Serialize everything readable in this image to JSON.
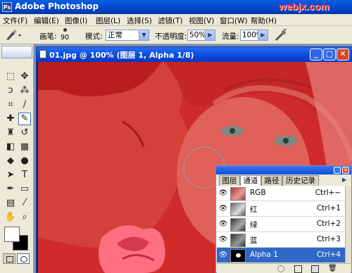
{
  "app": {
    "title": "Adobe Photoshop",
    "watermark": "webjx.com"
  },
  "menu": [
    "文件(F)",
    "编辑(E)",
    "图像(I)",
    "图层(L)",
    "选择(S)",
    "滤镜(T)",
    "视图(V)",
    "窗口(W)",
    "帮助(H)"
  ],
  "options": {
    "brush_label": "画笔:",
    "brush_size": "90",
    "mode_label": "模式:",
    "mode_value": "正常",
    "opacity_label": "不透明度:",
    "opacity_value": "50%",
    "flow_label": "流量:",
    "flow_value": "100%"
  },
  "document": {
    "title": "01.jpg @ 100% (图层 1, Alpha 1/8)"
  },
  "panel": {
    "tabs": [
      "图层",
      "通道",
      "路径",
      "历史记录"
    ],
    "active_tab": "通道",
    "channels": [
      {
        "name": "RGB",
        "shortcut": "Ctrl+~"
      },
      {
        "name": "红",
        "shortcut": "Ctrl+1"
      },
      {
        "name": "绿",
        "shortcut": "Ctrl+2"
      },
      {
        "name": "蓝",
        "shortcut": "Ctrl+3"
      },
      {
        "name": "Alpha 1",
        "shortcut": "Ctrl+4",
        "selected": true
      }
    ]
  },
  "colors": {
    "titlebar": "#0346c8",
    "mask_overlay": "#c82828",
    "selection": "#3168c6",
    "chrome": "#ece9d8"
  }
}
